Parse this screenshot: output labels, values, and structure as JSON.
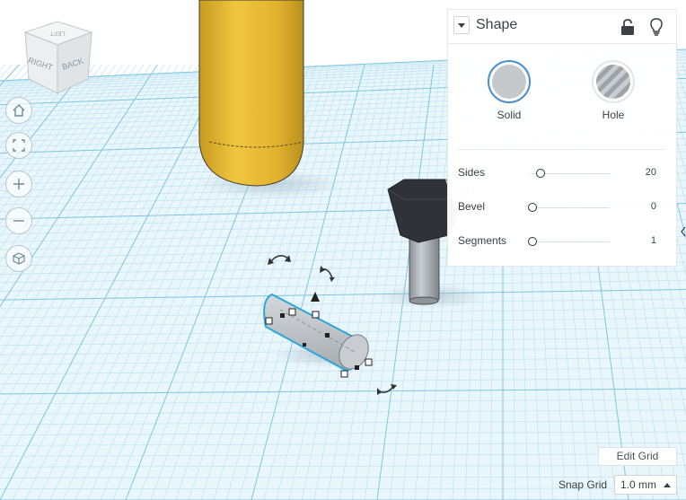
{
  "shape_panel": {
    "title": "Shape",
    "solid_label": "Solid",
    "hole_label": "Hole",
    "params": [
      {
        "label": "Sides",
        "value": "20"
      },
      {
        "label": "Bevel",
        "value": "0"
      },
      {
        "label": "Segments",
        "value": "1"
      }
    ],
    "slider_levels": {
      "sides": 0.1,
      "bevel": 0.0,
      "segments": 0.0
    }
  },
  "viewcube": {
    "right_label": "RIGHT",
    "back_label": "BACK",
    "top_label": "LEFT"
  },
  "nav_icons": [
    "home-icon",
    "fit-view-icon",
    "zoom-in-icon",
    "zoom-out-icon",
    "perspective-icon"
  ],
  "grid_controls": {
    "edit_grid_label": "Edit Grid",
    "snap_grid_label": "Snap Grid",
    "snap_grid_value": "1.0 mm"
  },
  "colors": {
    "grid_line": "#bfe3f1",
    "grid_major": "#7fc6e3",
    "plane": "#e9f6fb",
    "cylinder_yellow": "#e5b631",
    "selected_outline": "#2aa7d8",
    "accent_blue": "#4a8fd0"
  }
}
